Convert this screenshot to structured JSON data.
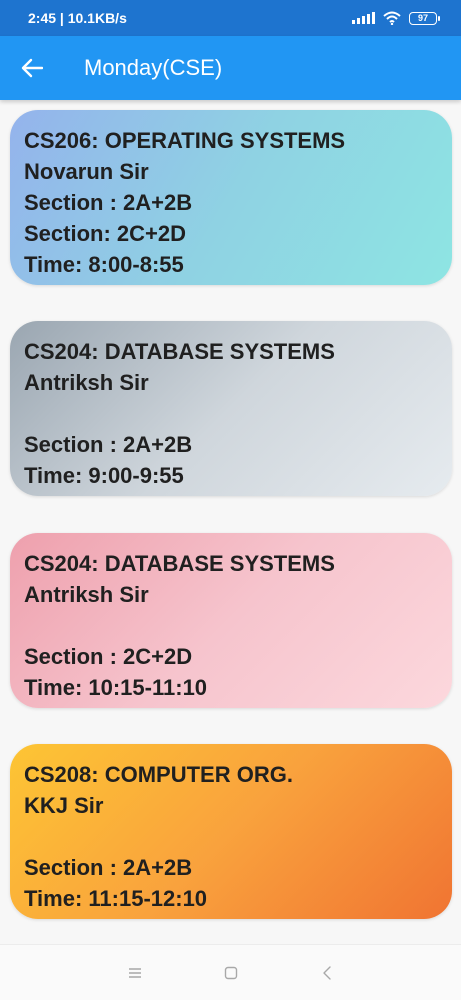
{
  "status_bar": {
    "time_speed": "2:45 | 10.1KB/s",
    "battery": "97"
  },
  "app_bar": {
    "title": "Monday(CSE)"
  },
  "colors": {
    "status_bar": "#1e74cf",
    "app_bar": "#2196f3"
  },
  "classes": [
    {
      "course": "CS206: OPERATING SYSTEMS",
      "teacher": "Novarun Sir",
      "line3": "Section : 2A+2B",
      "line4": "Section: 2C+2D",
      "time": "Time: 8:00-8:55"
    },
    {
      "course": "CS204: DATABASE SYSTEMS",
      "teacher": "Antriksh Sir",
      "line3": "",
      "line4": "Section : 2A+2B",
      "time": "Time: 9:00-9:55"
    },
    {
      "course": "CS204: DATABASE SYSTEMS",
      "teacher": "Antriksh Sir",
      "line3": "",
      "line4": "Section : 2C+2D",
      "time": "Time: 10:15-11:10"
    },
    {
      "course": "CS208: COMPUTER ORG.",
      "teacher": "KKJ Sir",
      "line3": "",
      "line4": "Section : 2A+2B",
      "time": "Time: 11:15-12:10"
    }
  ]
}
